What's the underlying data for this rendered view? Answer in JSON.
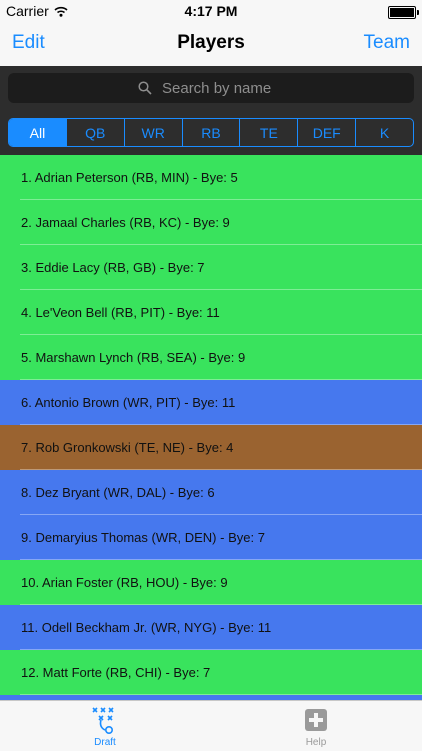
{
  "status_bar": {
    "carrier": "Carrier",
    "time": "4:17 PM"
  },
  "nav": {
    "edit_label": "Edit",
    "title": "Players",
    "team_label": "Team"
  },
  "search": {
    "placeholder": "Search by name"
  },
  "filters": [
    {
      "label": "All",
      "active": true
    },
    {
      "label": "QB",
      "active": false
    },
    {
      "label": "WR",
      "active": false
    },
    {
      "label": "RB",
      "active": false
    },
    {
      "label": "TE",
      "active": false
    },
    {
      "label": "DEF",
      "active": false
    },
    {
      "label": "K",
      "active": false
    }
  ],
  "position_colors": {
    "RB": "#39e35d",
    "WR": "#4678ee",
    "TE": "#9a6330"
  },
  "players": [
    {
      "text": "1. Adrian Peterson (RB, MIN) - Bye: 5",
      "position": "RB"
    },
    {
      "text": "2. Jamaal Charles (RB, KC) - Bye: 9",
      "position": "RB"
    },
    {
      "text": "3. Eddie Lacy (RB, GB) - Bye: 7",
      "position": "RB"
    },
    {
      "text": "4. Le'Veon Bell (RB, PIT) - Bye: 11",
      "position": "RB"
    },
    {
      "text": "5. Marshawn Lynch (RB, SEA) - Bye: 9",
      "position": "RB"
    },
    {
      "text": "6. Antonio Brown (WR, PIT) - Bye: 11",
      "position": "WR"
    },
    {
      "text": "7. Rob Gronkowski (TE, NE) - Bye: 4",
      "position": "TE"
    },
    {
      "text": "8. Dez Bryant (WR, DAL) - Bye: 6",
      "position": "WR"
    },
    {
      "text": "9. Demaryius Thomas (WR, DEN) - Bye: 7",
      "position": "WR"
    },
    {
      "text": "10. Arian Foster (RB, HOU) - Bye: 9",
      "position": "RB"
    },
    {
      "text": "11. Odell Beckham Jr. (WR, NYG) - Bye: 11",
      "position": "WR"
    },
    {
      "text": "12. Matt Forte (RB, CHI) - Bye: 7",
      "position": "RB"
    },
    {
      "text": "",
      "position": "WR"
    }
  ],
  "tabs": [
    {
      "label": "Draft",
      "icon": "playbook-icon",
      "active": true
    },
    {
      "label": "Help",
      "icon": "plus-box-icon",
      "active": false
    }
  ]
}
